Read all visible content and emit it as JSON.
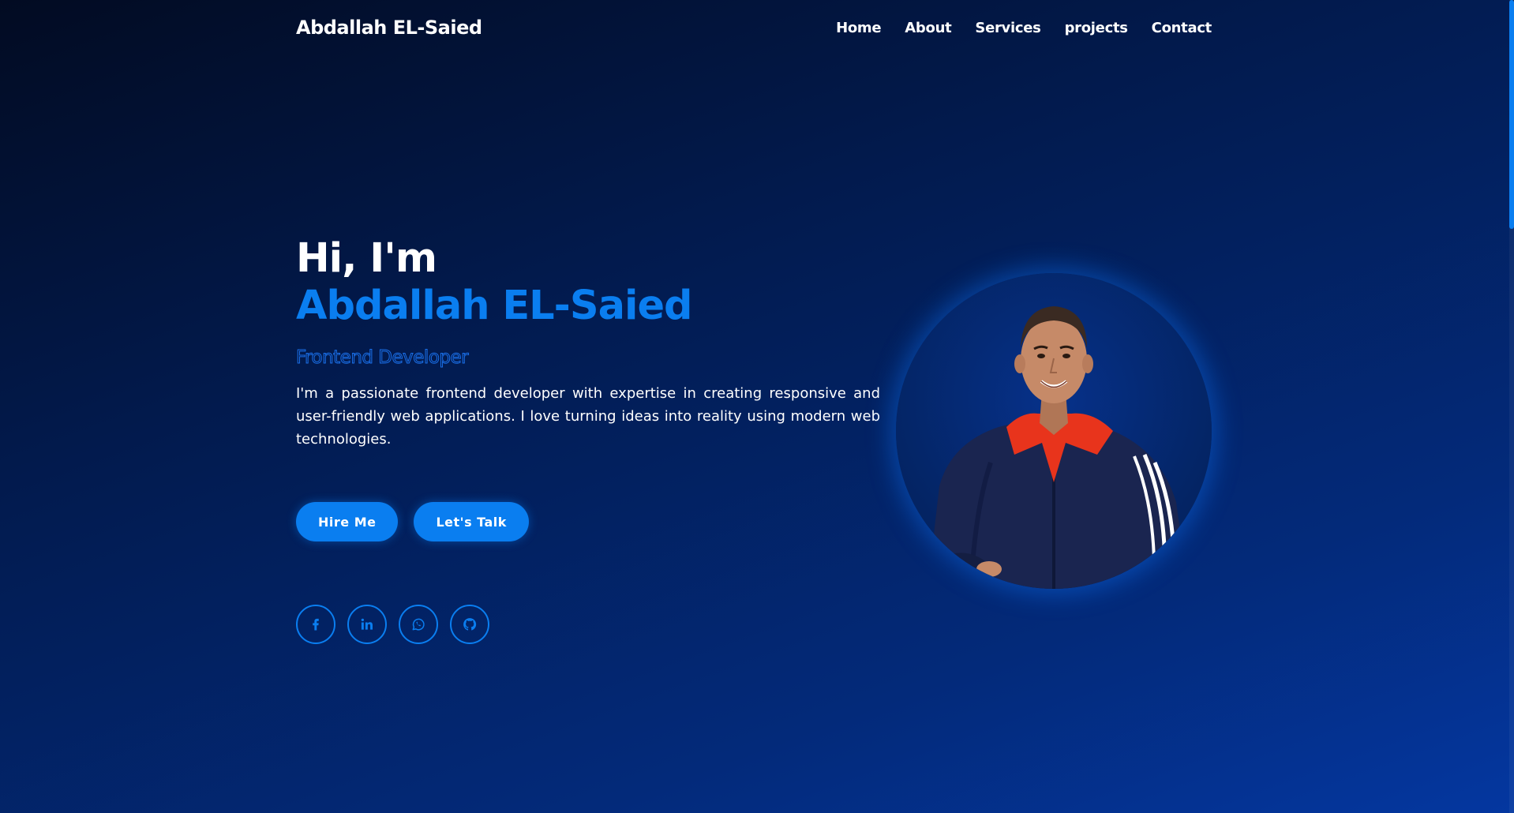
{
  "header": {
    "brand": "Abdallah EL-Saied",
    "nav": [
      "Home",
      "About",
      "Services",
      "projects",
      "Contact"
    ]
  },
  "hero": {
    "greeting": "Hi, I'm",
    "name": "Abdallah EL-Saied",
    "role": "Frontend Developer",
    "description": "I'm a passionate frontend developer with expertise in creating responsive and user-friendly web applications. I love turning ideas into reality using modern web technologies.",
    "buttons": {
      "hire": "Hire Me",
      "talk": "Let's Talk"
    },
    "socials": [
      "facebook-icon",
      "linkedin-icon",
      "whatsapp-icon",
      "github-icon"
    ],
    "photo": "profile-photo"
  },
  "colors": {
    "accent": "#0a7ef0",
    "background_dark": "#020b22",
    "background_light": "#0437a0",
    "hoodie": "#e8341c",
    "jacket": "#1a2550"
  }
}
